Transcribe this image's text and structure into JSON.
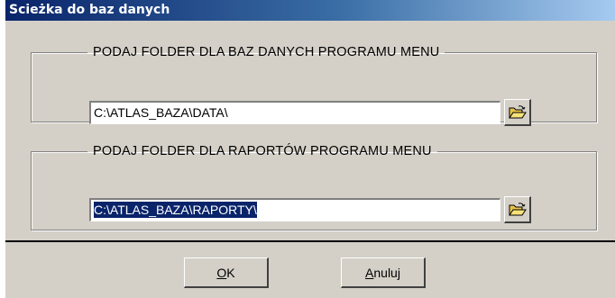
{
  "window": {
    "title": "Scieżka do baz danych"
  },
  "group_db": {
    "legend": "PODAJ FOLDER DLA BAZ DANYCH PROGRAMU MENU",
    "path_value": "C:\\ATLAS_BAZA\\DATA\\",
    "browse_icon": "open-folder-icon"
  },
  "group_reports": {
    "legend": "PODAJ FOLDER DLA RAPORTÓW PROGRAMU MENU",
    "path_value": "C:\\ATLAS_BAZA\\RAPORTY\\",
    "browse_icon": "open-folder-icon"
  },
  "buttons": {
    "ok_accel": "O",
    "ok_rest": "K",
    "cancel_accel": "A",
    "cancel_rest": "nuluj"
  },
  "colors": {
    "dialog_bg": "#d4d0c8",
    "title_gradient_start": "#0a246a",
    "title_gradient_end": "#a6caf0",
    "selection_bg": "#0a246a"
  }
}
